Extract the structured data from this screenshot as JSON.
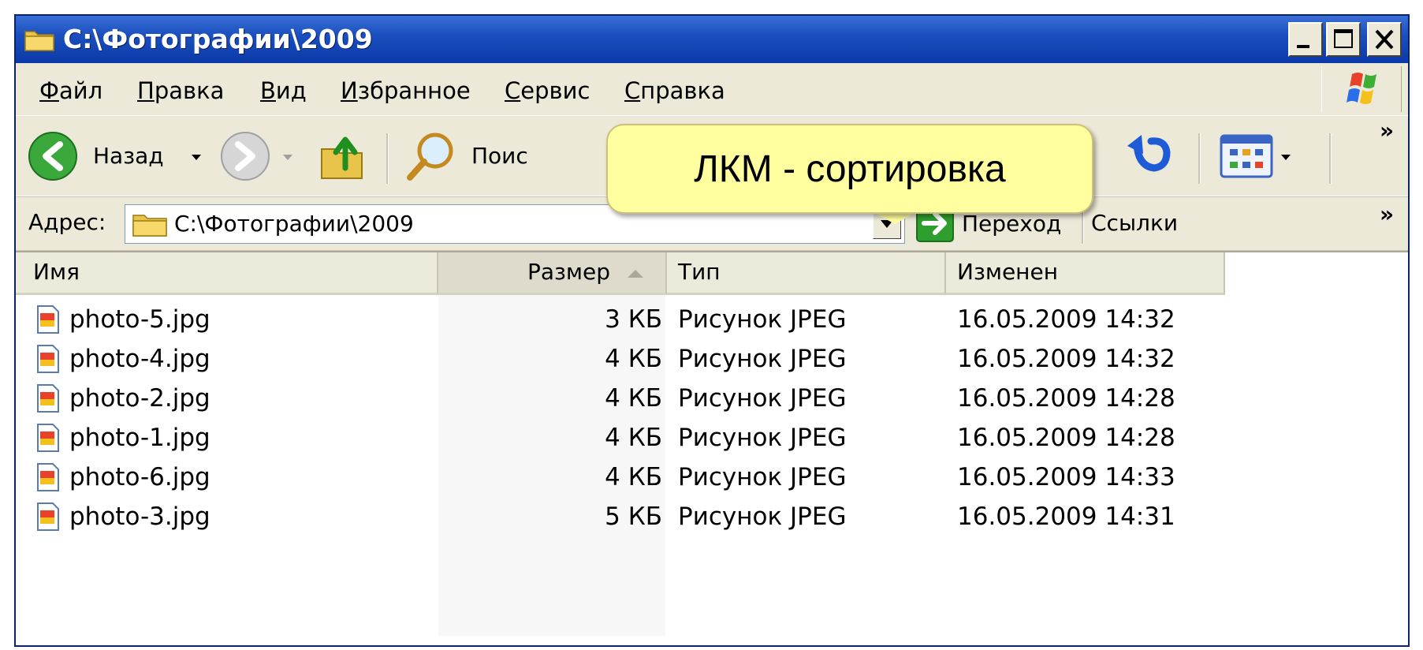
{
  "window": {
    "title": "C:\\Фотографии\\2009",
    "controls": {
      "minimize": "_",
      "maximize": "□",
      "close": "×"
    }
  },
  "menu": {
    "items": [
      {
        "label": "Файл"
      },
      {
        "label": "Правка"
      },
      {
        "label": "Вид"
      },
      {
        "label": "Избранное"
      },
      {
        "label": "Сервис"
      },
      {
        "label": "Справка"
      }
    ]
  },
  "toolbar": {
    "back_label": "Назад",
    "search_label": "Поис",
    "overflow": "»"
  },
  "address": {
    "label": "Адрес:",
    "value": "C:\\Фотографии\\2009",
    "go_label": "Переход",
    "links_label": "Ссылки",
    "overflow": "»"
  },
  "tooltip": {
    "text": "ЛКМ - сортировка"
  },
  "columns": {
    "name": "Имя",
    "size": "Размер",
    "type": "Тип",
    "modified": "Изменен",
    "sort_direction": "ascending"
  },
  "files": [
    {
      "name": "photo-5.jpg",
      "size": "3 КБ",
      "type": "Рисунок JPEG",
      "modified": "16.05.2009 14:32"
    },
    {
      "name": "photo-4.jpg",
      "size": "4 КБ",
      "type": "Рисунок JPEG",
      "modified": "16.05.2009 14:32"
    },
    {
      "name": "photo-2.jpg",
      "size": "4 КБ",
      "type": "Рисунок JPEG",
      "modified": "16.05.2009 14:28"
    },
    {
      "name": "photo-1.jpg",
      "size": "4 КБ",
      "type": "Рисунок JPEG",
      "modified": "16.05.2009 14:28"
    },
    {
      "name": "photo-6.jpg",
      "size": "4 КБ",
      "type": "Рисунок JPEG",
      "modified": "16.05.2009 14:33"
    },
    {
      "name": "photo-3.jpg",
      "size": "5 КБ",
      "type": "Рисунок JPEG",
      "modified": "16.05.2009 14:31"
    }
  ],
  "colors": {
    "titlebar": "#1b4fbf",
    "chrome": "#ece9d8",
    "tooltip": "#ffffa0",
    "go_arrow": "#2e9e2e"
  }
}
